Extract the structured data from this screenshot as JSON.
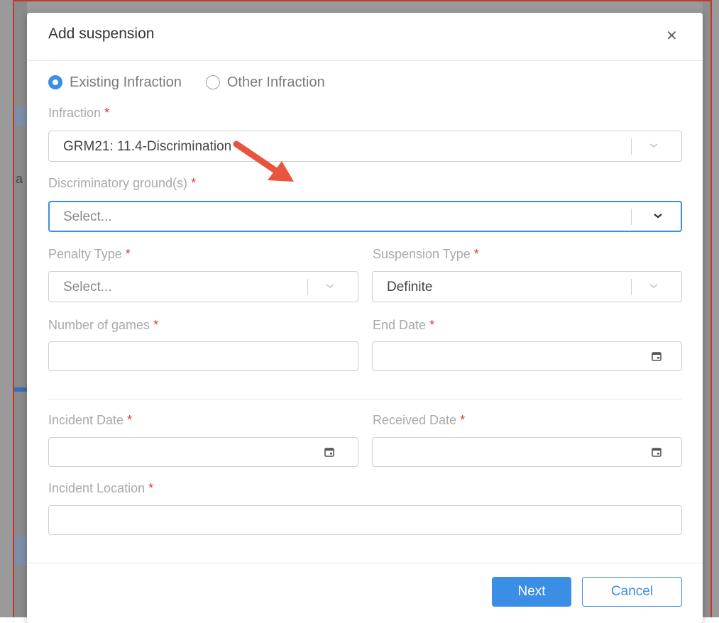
{
  "modal": {
    "title": "Add suspension",
    "close_icon": "close-icon"
  },
  "radio": {
    "existing_label": "Existing Infraction",
    "other_label": "Other Infraction",
    "selected": "existing"
  },
  "fields": {
    "infraction_label": "Infraction",
    "infraction_value": "GRM21: 11.4-Discrimination",
    "discriminatory_label": "Discriminatory ground(s)",
    "discriminatory_placeholder": "Select...",
    "penalty_label": "Penalty Type",
    "penalty_placeholder": "Select...",
    "suspension_label": "Suspension Type",
    "suspension_value": "Definite",
    "games_label": "Number of games",
    "games_value": "",
    "end_date_label": "End Date",
    "end_date_value": "",
    "incident_date_label": "Incident Date",
    "incident_date_value": "",
    "received_date_label": "Received Date",
    "received_date_value": "",
    "incident_location_label": "Incident Location",
    "incident_location_value": "",
    "required_mark": "*"
  },
  "buttons": {
    "next": "Next",
    "cancel": "Cancel"
  },
  "colors": {
    "accent": "#3b8ee6",
    "required": "#e0393e",
    "annotation_arrow": "#e8553e"
  },
  "background_fragments": {
    "left_char_1": "a"
  }
}
